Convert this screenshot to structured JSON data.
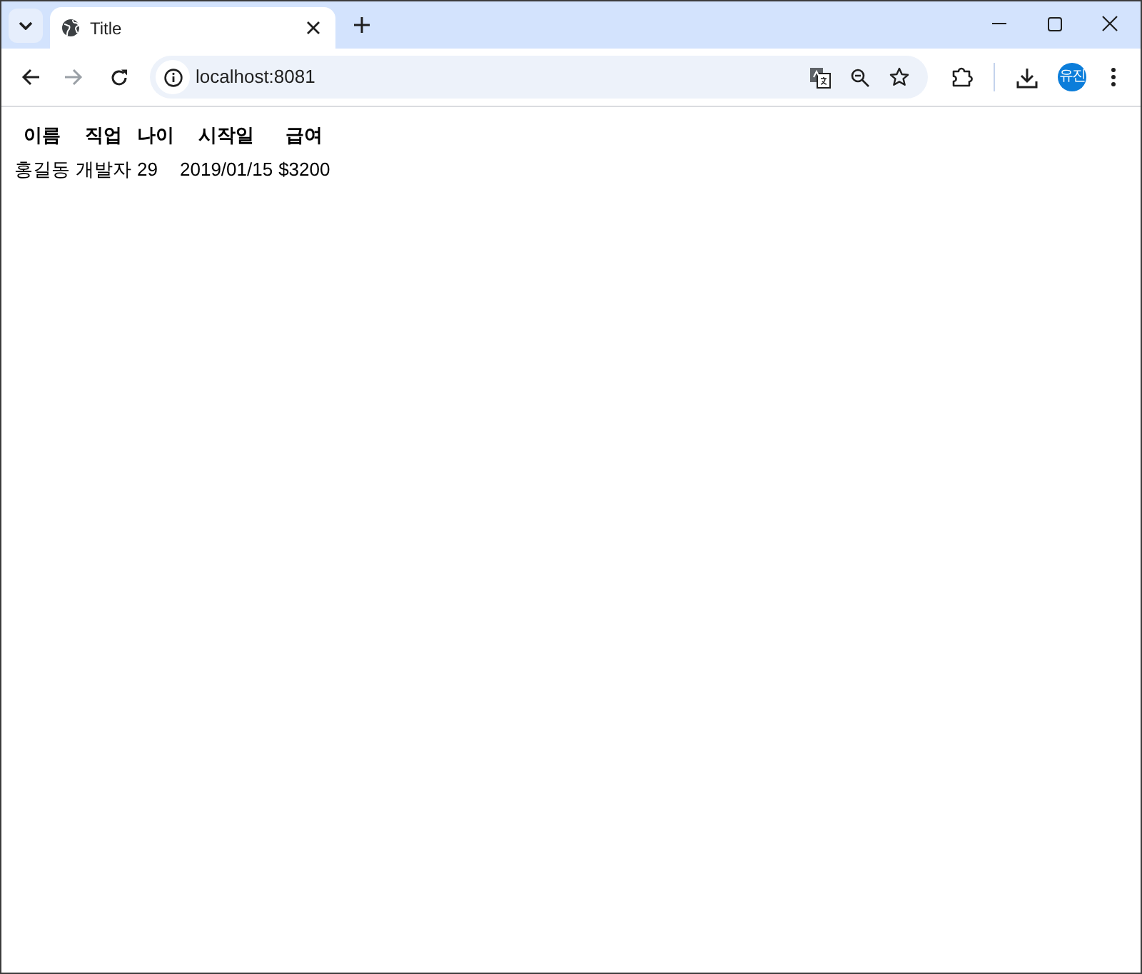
{
  "browser": {
    "tabs": [
      {
        "title": "Title",
        "selected": true
      }
    ],
    "address_bar": {
      "url": "localhost:8081"
    },
    "profile": {
      "initials": "유진"
    }
  },
  "table": {
    "columns": [
      "이름",
      "직업",
      "나이",
      "시작일",
      "급여"
    ],
    "rows": [
      [
        "홍길동",
        "개발자",
        "29",
        "2019/01/15",
        "$3200"
      ]
    ]
  }
}
